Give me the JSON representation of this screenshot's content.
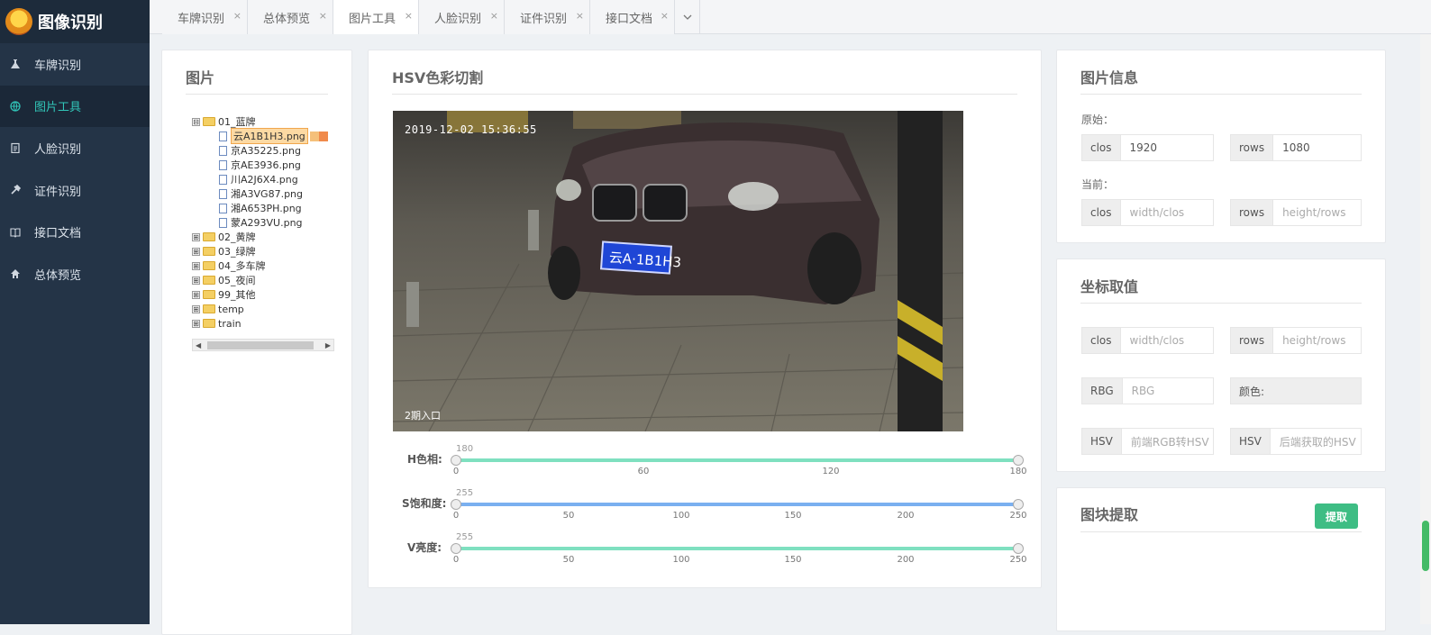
{
  "app": {
    "title": "图像识别"
  },
  "sidebar": {
    "items": [
      {
        "label": "车牌识别",
        "icon": "flask-icon",
        "active": false
      },
      {
        "label": "图片工具",
        "icon": "globe-icon",
        "active": true
      },
      {
        "label": "人脸识别",
        "icon": "clipboard-icon",
        "active": false
      },
      {
        "label": "证件识别",
        "icon": "tools-icon",
        "active": false
      },
      {
        "label": "接口文档",
        "icon": "book-icon",
        "active": false
      },
      {
        "label": "总体预览",
        "icon": "home-icon",
        "active": false
      }
    ]
  },
  "tabs": [
    {
      "label": "车牌识别",
      "close": "×"
    },
    {
      "label": "总体预览",
      "close": "×"
    },
    {
      "label": "图片工具",
      "close": "×"
    },
    {
      "label": "人脸识别",
      "close": "×"
    },
    {
      "label": "证件识别",
      "close": "×"
    },
    {
      "label": "接口文档",
      "close": "×"
    }
  ],
  "images_panel": {
    "title": "图片",
    "tree": {
      "folders": [
        {
          "name": "01_蓝牌",
          "expanded": true,
          "toggle": "⊟"
        },
        {
          "name": "02_黄牌",
          "expanded": false,
          "toggle": "⊞"
        },
        {
          "name": "03_绿牌",
          "expanded": false,
          "toggle": "⊞"
        },
        {
          "name": "04_多车牌",
          "expanded": false,
          "toggle": "⊞"
        },
        {
          "name": "05_夜间",
          "expanded": false,
          "toggle": "⊞"
        },
        {
          "name": "99_其他",
          "expanded": false,
          "toggle": "⊞"
        },
        {
          "name": "temp",
          "expanded": false,
          "toggle": "⊞"
        },
        {
          "name": "train",
          "expanded": false,
          "toggle": "⊞"
        }
      ],
      "files": [
        "云A1B1H3.png",
        "京A35225.png",
        "京AE3936.png",
        "川A2J6X4.png",
        "湘A3VG87.png",
        "湘A653PH.png",
        "蒙A293VU.png"
      ],
      "selected": "云A1B1H3.png"
    }
  },
  "hsv_panel": {
    "title": "HSV色彩切割",
    "image": {
      "timestamp": "2019-12-02 15:36:55",
      "caption": "2期入口",
      "plate": "云A·1B1H3"
    },
    "sliders": [
      {
        "label": "H色相:",
        "value": "180",
        "ticks": [
          "0",
          "60",
          "120",
          "180"
        ],
        "max": 180,
        "color": "#7fe0c0"
      },
      {
        "label": "S饱和度:",
        "value": "255",
        "ticks": [
          "0",
          "50",
          "100",
          "150",
          "200",
          "250"
        ],
        "max": 250,
        "color": "#7ab0f0"
      },
      {
        "label": "V亮度:",
        "value": "255",
        "ticks": [
          "0",
          "50",
          "100",
          "150",
          "200",
          "250"
        ],
        "max": 250,
        "color": "#7fe0c0"
      }
    ]
  },
  "info_panel": {
    "title": "图片信息",
    "original_label": "原始：",
    "current_label": "当前：",
    "original": {
      "clos_label": "clos",
      "clos_value": "1920",
      "rows_label": "rows",
      "rows_value": "1080"
    },
    "current": {
      "clos_label": "clos",
      "clos_placeholder": "width/clos",
      "rows_label": "rows",
      "rows_placeholder": "height/rows"
    }
  },
  "coord_panel": {
    "title": "坐标取值",
    "clos_label": "clos",
    "clos_placeholder": "width/clos",
    "rows_label": "rows",
    "rows_placeholder": "height/rows",
    "rbg_label": "RBG",
    "rbg_placeholder": "RBG",
    "color_label": "颜色:",
    "hsv1_label": "HSV",
    "hsv1_placeholder": "前端RGB转HSV",
    "hsv2_label": "HSV",
    "hsv2_placeholder": "后端获取的HSV"
  },
  "extract_panel": {
    "title": "图块提取",
    "button": "提取"
  }
}
